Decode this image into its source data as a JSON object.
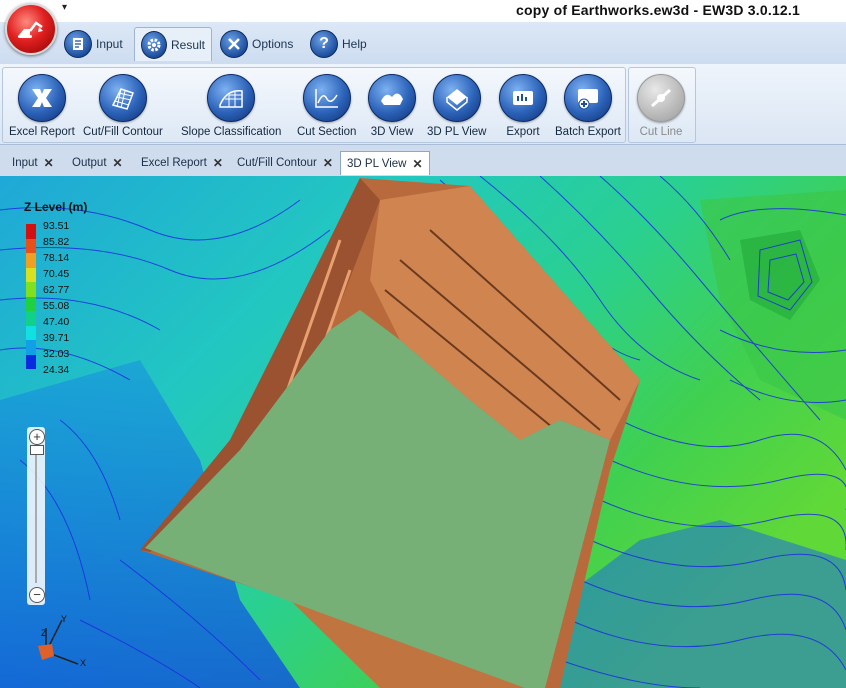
{
  "window": {
    "title": "copy of Earthworks.ew3d - EW3D 3.0.12.1",
    "qat_glyph": "▾"
  },
  "ribbon_tabs": [
    {
      "label": "Input",
      "icon": "input-icon"
    },
    {
      "label": "Result",
      "icon": "gear-icon",
      "active": true
    },
    {
      "label": "Options",
      "icon": "tools-icon"
    },
    {
      "label": "Help",
      "icon": "help-icon"
    }
  ],
  "ribbon_buttons": [
    {
      "label": "Excel Report",
      "icon": "excel-icon"
    },
    {
      "label": "Cut/Fill Contour",
      "icon": "contour-icon"
    },
    {
      "label": "Slope Classification",
      "icon": "slope-icon"
    },
    {
      "label": "Cut Section",
      "icon": "section-icon"
    },
    {
      "label": "3D View",
      "icon": "3d-view-icon"
    },
    {
      "label": "3D PL View",
      "icon": "3d-pl-view-icon"
    },
    {
      "label": "Export",
      "icon": "export-icon"
    },
    {
      "label": "Batch Export",
      "icon": "batch-export-icon"
    },
    {
      "label": "Cut Line",
      "icon": "cut-line-icon",
      "disabled": true
    }
  ],
  "doc_tabs": [
    {
      "label": "Input",
      "close": "✕"
    },
    {
      "label": "Output",
      "close": "✕"
    },
    {
      "label": "Excel Report",
      "close": "✕"
    },
    {
      "label": "Cut/Fill Contour",
      "close": "✕"
    },
    {
      "label": "3D PL View",
      "close": "✕",
      "active": true
    }
  ],
  "legend": {
    "title": "Z Level (m)",
    "labels": [
      "93.51",
      "85.82",
      "78.14",
      "70.45",
      "62.77",
      "55.08",
      "47.40",
      "39.71",
      "32.03",
      "24.34"
    ],
    "colors": [
      "#d21010",
      "#e8501a",
      "#f0a020",
      "#d8e020",
      "#80e020",
      "#20d040",
      "#10d08a",
      "#10e0e0",
      "#10a0e8",
      "#0a2ae0"
    ]
  },
  "zoom": {
    "plus": "+",
    "minus": "−"
  },
  "axes": {
    "z": "Z",
    "y": "Y",
    "x": "X"
  },
  "colors": {
    "pit_floor": "#76b077",
    "pit_wall": "#c87a46",
    "pit_wall_dark": "#9c5530",
    "terrain_low": "#1060d8",
    "terrain_mid": "#20c8c0",
    "terrain_high": "#30d050"
  }
}
